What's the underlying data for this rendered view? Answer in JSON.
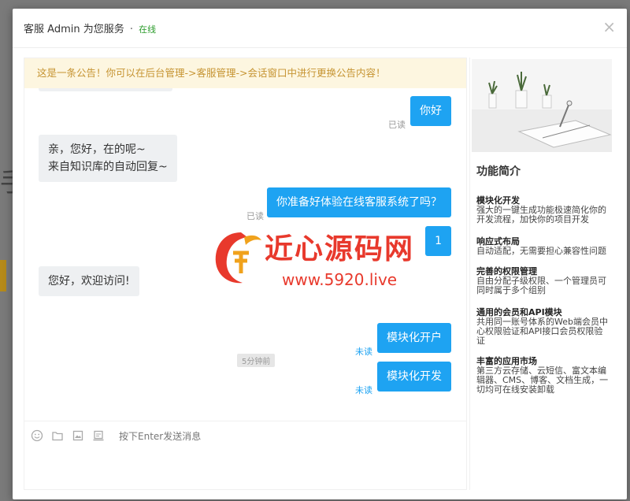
{
  "modal": {
    "title_prefix": "客服",
    "title_name": "Admin 为您服务",
    "title_separator": "·",
    "status": "在线",
    "close_glyph": "×"
  },
  "notice": "这是一条公告！你可以在后台管理->客服管理->会话窗口中进行更换公告内容！",
  "messages": [
    {
      "side": "me",
      "text": "你好",
      "status": "已读"
    },
    {
      "side": "other",
      "lines": [
        "亲，您好，在的呢~",
        "来自知识库的自动回复~"
      ]
    },
    {
      "side": "me",
      "text": "你准备好体验在线客服系统了吗？",
      "status": "已读"
    },
    {
      "side": "me",
      "text": "1",
      "status": ""
    },
    {
      "side": "other",
      "text": "您好，欢迎访问!"
    },
    {
      "side": "me",
      "text": "模块化开户",
      "status": "未读"
    },
    {
      "side": "me",
      "text": "模块化开发",
      "status": "未读"
    }
  ],
  "timestamp": "5分钟前",
  "composer": {
    "hint": "按下Enter发送消息",
    "tools": [
      "emoji-icon",
      "folder-icon",
      "image-icon",
      "history-icon"
    ]
  },
  "watermark": {
    "text": "近心源码网",
    "url": "www.5920.live"
  },
  "sidebar": {
    "title": "功能简介",
    "features": [
      {
        "title": "模块化开发",
        "desc": "强大的一键生成功能极速简化你的开发流程，加快你的项目开发"
      },
      {
        "title": "响应式布局",
        "desc": "自动适配，无需要担心兼容性问题"
      },
      {
        "title": "完善的权限管理",
        "desc": "自由分配子级权限、一个管理员可同时属于多个组别"
      },
      {
        "title": "通用的会员和API模块",
        "desc": "共用同一账号体系的Web端会员中心权限验证和API接口会员权限验证"
      },
      {
        "title": "丰富的应用市场",
        "desc": "第三方云存储、云短信、富文本编辑器、CMS、博客、文档生成，一切均可在线安装卸载"
      }
    ]
  },
  "colors": {
    "accent": "#1ea3f2",
    "online": "#2a9b2a",
    "notice_bg": "#fdf6e0",
    "notice_text": "#c69432",
    "watermark": "#e8392c"
  }
}
